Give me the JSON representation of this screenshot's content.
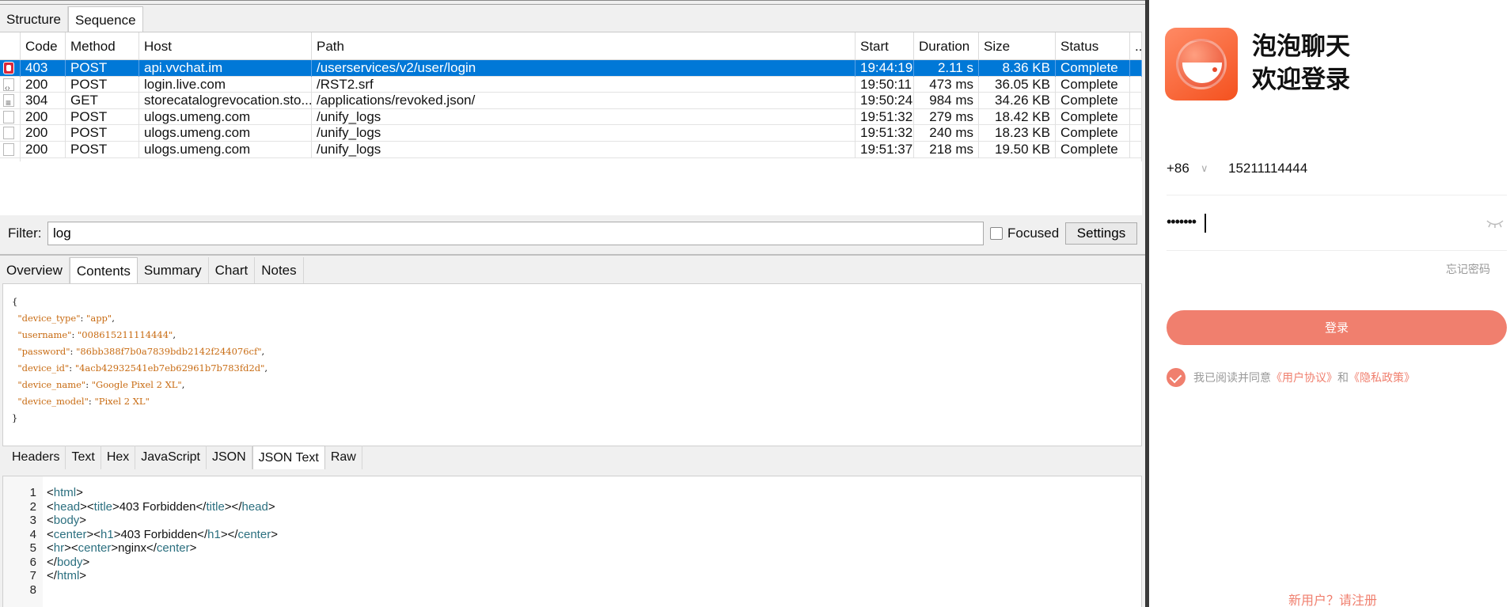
{
  "proxy": {
    "top_tabs": [
      "Structure",
      "Sequence"
    ],
    "columns": [
      "Code",
      "Method",
      "Host",
      "Path",
      "Start",
      "Duration",
      "Size",
      "Status",
      "..."
    ],
    "rows": [
      {
        "code": "403",
        "method": "POST",
        "host": "api.vvchat.im",
        "path": "/userservices/v2/user/login",
        "start": "19:44:19",
        "duration": "2.11 s",
        "size": "8.36 KB",
        "status": "Complete",
        "icon": "error-icon",
        "selected": true
      },
      {
        "code": "200",
        "method": "POST",
        "host": "login.live.com",
        "path": "/RST2.srf",
        "start": "19:50:11",
        "duration": "473 ms",
        "size": "36.05 KB",
        "status": "Complete",
        "icon": "code-file-icon",
        "selected": false
      },
      {
        "code": "304",
        "method": "GET",
        "host": "storecatalogrevocation.sto...",
        "path": "/applications/revoked.json/",
        "start": "19:50:24",
        "duration": "984 ms",
        "size": "34.26 KB",
        "status": "Complete",
        "icon": "list-file-icon",
        "selected": false
      },
      {
        "code": "200",
        "method": "POST",
        "host": "ulogs.umeng.com",
        "path": "/unify_logs",
        "start": "19:51:32",
        "duration": "279 ms",
        "size": "18.42 KB",
        "status": "Complete",
        "icon": "file-icon",
        "selected": false
      },
      {
        "code": "200",
        "method": "POST",
        "host": "ulogs.umeng.com",
        "path": "/unify_logs",
        "start": "19:51:32",
        "duration": "240 ms",
        "size": "18.23 KB",
        "status": "Complete",
        "icon": "file-icon",
        "selected": false
      },
      {
        "code": "200",
        "method": "POST",
        "host": "ulogs.umeng.com",
        "path": "/unify_logs",
        "start": "19:51:37",
        "duration": "218 ms",
        "size": "19.50 KB",
        "status": "Complete",
        "icon": "file-icon",
        "selected": false
      }
    ],
    "filter": {
      "label": "Filter:",
      "value": "log",
      "focused_label": "Focused",
      "focused_checked": false,
      "settings_label": "Settings"
    },
    "detail_tabs": [
      "Overview",
      "Contents",
      "Summary",
      "Chart",
      "Notes"
    ],
    "request_json": [
      {
        "key": "\"device_type\"",
        "value": "\"app\""
      },
      {
        "key": "\"username\"",
        "value": "\"008615211114444\""
      },
      {
        "key": "\"password\"",
        "value": "\"86bb388f7b0a7839bdb2142f244076cf\""
      },
      {
        "key": "\"device_id\"",
        "value": "\"4acb42932541eb7eb62961b7b783fd2d\""
      },
      {
        "key": "\"device_name\"",
        "value": "\"Google Pixel 2 XL\""
      },
      {
        "key": "\"device_model\"",
        "value": "\"Pixel 2 XL\""
      }
    ],
    "response_tabs": [
      "Headers",
      "Text",
      "Hex",
      "JavaScript",
      "JSON",
      "JSON Text",
      "Raw"
    ],
    "response_lines": [
      {
        "n": "1",
        "parts": [
          [
            "p",
            "<"
          ],
          [
            "t",
            "html"
          ],
          [
            "p",
            ">"
          ]
        ]
      },
      {
        "n": "2",
        "parts": [
          [
            "p",
            "<"
          ],
          [
            "t",
            "head"
          ],
          [
            "p",
            "><"
          ],
          [
            "t",
            "title"
          ],
          [
            "p",
            ">403 Forbidden</"
          ],
          [
            "t",
            "title"
          ],
          [
            "p",
            "></"
          ],
          [
            "t",
            "head"
          ],
          [
            "p",
            ">"
          ]
        ]
      },
      {
        "n": "3",
        "parts": [
          [
            "p",
            "<"
          ],
          [
            "t",
            "body"
          ],
          [
            "p",
            ">"
          ]
        ]
      },
      {
        "n": "4",
        "parts": [
          [
            "p",
            "<"
          ],
          [
            "t",
            "center"
          ],
          [
            "p",
            "><"
          ],
          [
            "t",
            "h1"
          ],
          [
            "p",
            ">403 Forbidden</"
          ],
          [
            "t",
            "h1"
          ],
          [
            "p",
            "></"
          ],
          [
            "t",
            "center"
          ],
          [
            "p",
            ">"
          ]
        ]
      },
      {
        "n": "5",
        "parts": [
          [
            "p",
            "<"
          ],
          [
            "t",
            "hr"
          ],
          [
            "p",
            "><"
          ],
          [
            "t",
            "center"
          ],
          [
            "p",
            ">nginx</"
          ],
          [
            "t",
            "center"
          ],
          [
            "p",
            ">"
          ]
        ]
      },
      {
        "n": "6",
        "parts": [
          [
            "p",
            "</"
          ],
          [
            "t",
            "body"
          ],
          [
            "p",
            ">"
          ]
        ]
      },
      {
        "n": "7",
        "parts": [
          [
            "p",
            "</"
          ],
          [
            "t",
            "html"
          ],
          [
            "p",
            ">"
          ]
        ]
      },
      {
        "n": "8",
        "parts": []
      }
    ]
  },
  "app": {
    "title": "泡泡聊天",
    "welcome": "欢迎登录",
    "country_code": "+86",
    "phone": "15211114444",
    "password_mask": "•••••••",
    "forgot": "忘记密码",
    "login_label": "登录",
    "agree_prefix": "我已阅读并同意",
    "agree_user_agreement": "《用户协议》",
    "agree_and": "和",
    "agree_privacy": "《隐私政策》",
    "register": "新用户？请注册",
    "accent_color": "#f07f6e"
  }
}
